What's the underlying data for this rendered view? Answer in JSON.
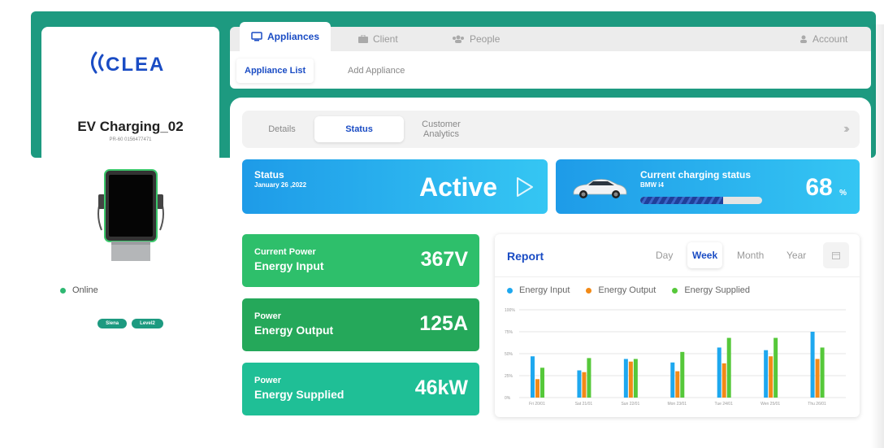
{
  "brand": {
    "logo_text": "CLEA"
  },
  "device": {
    "name": "EV Charging_02",
    "id": "PR-60 0156477471",
    "status": "Online",
    "tags": [
      "Siena",
      "Level2"
    ]
  },
  "nav": {
    "tabs": [
      {
        "label": "Appliances",
        "icon": "monitor-icon"
      },
      {
        "label": "Client",
        "icon": "briefcase-icon"
      },
      {
        "label": "People",
        "icon": "people-icon"
      }
    ],
    "account": "Account",
    "subtabs": [
      "Appliance List",
      "Add Appliance"
    ]
  },
  "segments": [
    "Details",
    "Status",
    "Customer Analytics"
  ],
  "status_card": {
    "title": "Status",
    "date": "January 26 ,2022",
    "value": "Active"
  },
  "charge_card": {
    "title": "Current charging status",
    "car": "BMW i4",
    "percent_value": "68",
    "percent_unit": "%",
    "progress": 0.68
  },
  "metrics": [
    {
      "line1": "Current Power",
      "line2": "Energy Input",
      "value": "367V",
      "color": "#2ebf6b"
    },
    {
      "line1": "Power",
      "line2": "Energy Output",
      "value": "125A",
      "color": "#25a85a"
    },
    {
      "line1": "Power",
      "line2": "Energy Supplied",
      "value": "46kW",
      "color": "#1fbf96"
    }
  ],
  "report": {
    "title": "Report",
    "periods": [
      "Day",
      "Week",
      "Month",
      "Year"
    ],
    "active_period": "Week"
  },
  "colors": {
    "teal": "#1d9a80",
    "blue_accent": "#1a4cc4",
    "energy_input": "#1ea8ef",
    "energy_output": "#f28a17",
    "energy_supplied": "#56c83a"
  },
  "chart_data": {
    "type": "bar",
    "categories": [
      "Fri 20/01",
      "Sat 21/01",
      "Sun 22/01",
      "Mon 23/01",
      "Tue 24/01",
      "Wen 25/01",
      "Thu 26/01"
    ],
    "series": [
      {
        "name": "Energy Input",
        "values": [
          47,
          31,
          44,
          40,
          57,
          54,
          75
        ]
      },
      {
        "name": "Energy Output",
        "values": [
          21,
          29,
          41,
          30,
          39,
          47,
          44
        ]
      },
      {
        "name": "Energy Supplied",
        "values": [
          34,
          45,
          44,
          52,
          68,
          68,
          57
        ]
      }
    ],
    "y_ticks": [
      "100%",
      "75%",
      "50%",
      "25%",
      "0%"
    ],
    "ylim": [
      0,
      100
    ],
    "legend_position": "top-left",
    "grid": true
  }
}
